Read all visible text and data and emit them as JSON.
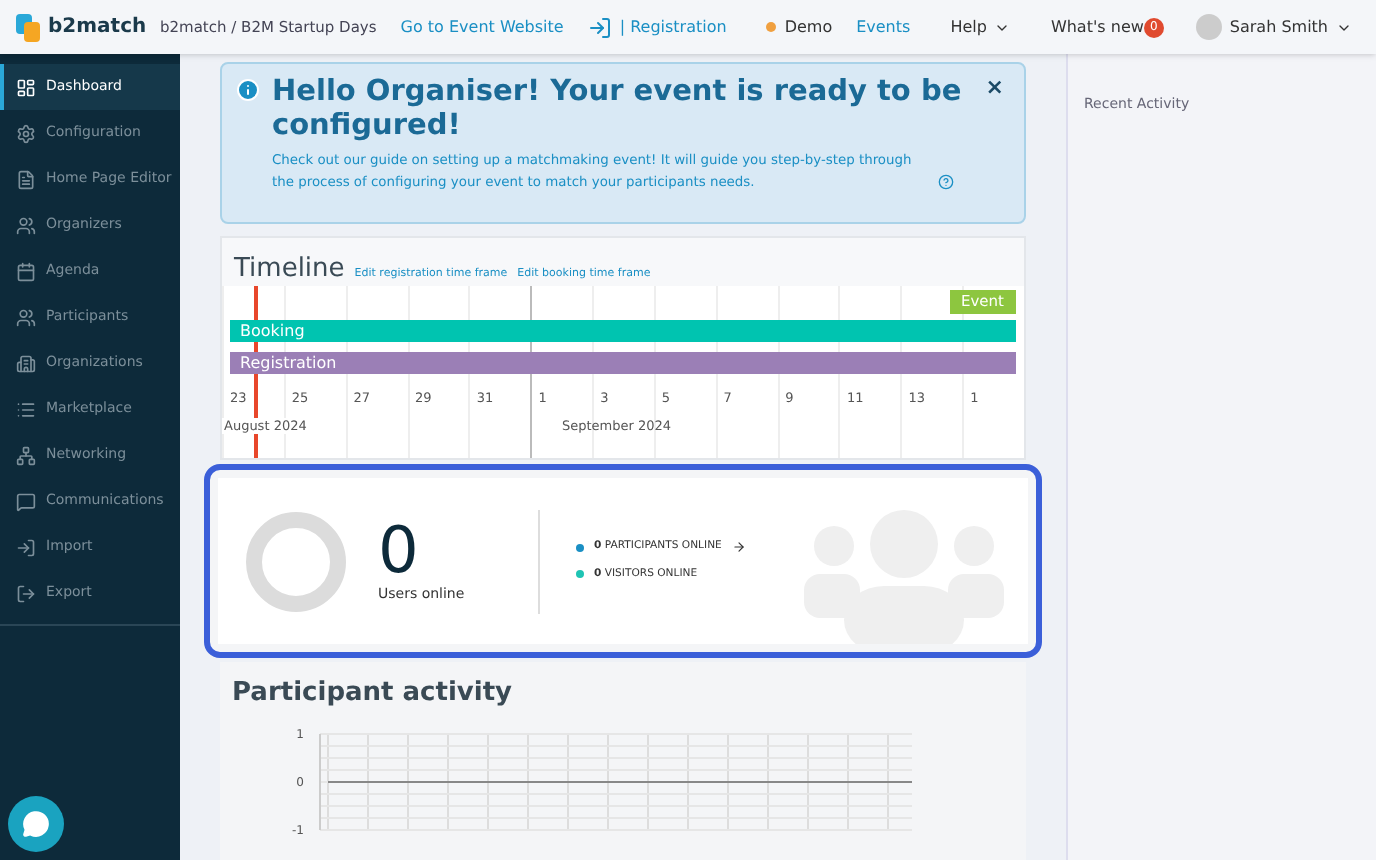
{
  "header": {
    "brand": "b2match",
    "breadcrumb": "b2match / B2M Startup Days",
    "links": [
      {
        "label": "Go to Event Website",
        "kind": "link"
      },
      {
        "label": "| Registration",
        "kind": "link"
      },
      {
        "label": "Demo",
        "kind": "status",
        "color": "#f0a040"
      },
      {
        "label": "Events",
        "kind": "link"
      },
      {
        "label": "Help",
        "kind": "menu"
      },
      {
        "label": "What's new",
        "kind": "badge",
        "badge": "0"
      }
    ],
    "user": "Sarah Smith"
  },
  "sidebar": {
    "items": [
      {
        "label": "Dashboard",
        "selected": true
      },
      {
        "label": "Configuration",
        "selected": false
      },
      {
        "label": "Home Page Editor",
        "selected": false
      },
      {
        "label": "Organizers",
        "selected": false
      },
      {
        "label": "Agenda",
        "selected": false
      },
      {
        "label": "Participants",
        "selected": false
      },
      {
        "label": "Organizations",
        "selected": false
      },
      {
        "label": "Marketplace",
        "selected": false
      },
      {
        "label": "Networking",
        "selected": false
      },
      {
        "label": "Communications",
        "selected": false
      },
      {
        "label": "Import",
        "selected": false
      },
      {
        "label": "Export",
        "selected": false
      }
    ]
  },
  "alert": {
    "title": "Hello Organiser! Your event is ready to be configured!",
    "text": "Check out our guide on setting up a matchmaking event! It will guide you step-by-step through the process of configuring your event to match your participants needs.",
    "close": "×"
  },
  "timeline": {
    "title": "Timeline",
    "actions": [
      "Edit registration time frame",
      "Edit booking time frame"
    ],
    "event": "Event",
    "bars": [
      {
        "label": "Booking",
        "color": "#00c4b0"
      },
      {
        "label": "Registration",
        "color": "#9b7fb6"
      }
    ],
    "days": [
      "23",
      "25",
      "27",
      "29",
      "31",
      "1",
      "3",
      "5",
      "7",
      "9",
      "11",
      "13",
      "1"
    ],
    "months": [
      "August 2024",
      "September 2024"
    ]
  },
  "online": {
    "count": "0",
    "label": "Users online",
    "stats": [
      {
        "label": "PARTICIPANTS ONLINE",
        "count": "0",
        "color": "#1a8fc4",
        "arrow": true
      },
      {
        "label": "VISITORS ONLINE",
        "count": "0",
        "color": "#1fc4b4",
        "arrow": false
      }
    ]
  },
  "activity": {
    "title": "Participant activity",
    "chart_data": {
      "type": "line",
      "categories": [
        null,
        null,
        null,
        null,
        null,
        null,
        null,
        null,
        null,
        null,
        null,
        null,
        null,
        null,
        null,
        null
      ],
      "ylim": [
        -1,
        1
      ],
      "yticks": [
        1,
        0,
        -1
      ],
      "grid": true,
      "series": [
        {
          "color": "#888888",
          "values": [
            0,
            0,
            0,
            0,
            0,
            0,
            0,
            0,
            0,
            0,
            0,
            0,
            0,
            0,
            0,
            0
          ]
        }
      ]
    }
  },
  "right_panel": {
    "title": "Recent Activity"
  }
}
